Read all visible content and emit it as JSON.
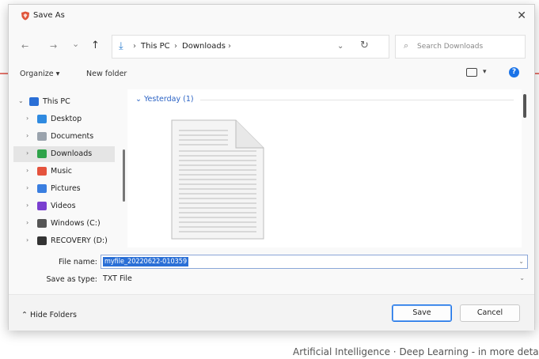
{
  "dialog": {
    "title": "Save As",
    "close_glyph": "✕"
  },
  "nav": {
    "back": "←",
    "forward": "→",
    "recent": "⌄",
    "up": "↑",
    "address": {
      "crumbs": [
        "This PC",
        "Downloads"
      ],
      "sep": "›",
      "chevron": "⌄",
      "refresh": "↻"
    },
    "search_placeholder": "Search Downloads"
  },
  "toolbar": {
    "organize": "Organize ▾",
    "new_folder": "New folder",
    "view_caret": "▾",
    "help": "?"
  },
  "tree": [
    {
      "label": "This PC",
      "caret": "⌄",
      "icon": "pc-icon",
      "color": "#2a6fd6"
    },
    {
      "label": "Desktop",
      "caret": "›",
      "icon": "desktop-icon",
      "color": "#2f8ae0"
    },
    {
      "label": "Documents",
      "caret": "›",
      "icon": "documents-icon",
      "color": "#9aa3ad"
    },
    {
      "label": "Downloads",
      "caret": "›",
      "icon": "downloads-icon",
      "color": "#2fa34a",
      "selected": true
    },
    {
      "label": "Music",
      "caret": "›",
      "icon": "music-icon",
      "color": "#e5533d"
    },
    {
      "label": "Pictures",
      "caret": "›",
      "icon": "pictures-icon",
      "color": "#3a7ee0"
    },
    {
      "label": "Videos",
      "caret": "›",
      "icon": "videos-icon",
      "color": "#7a3fd0"
    },
    {
      "label": "Windows (C:)",
      "caret": "›",
      "icon": "drive-icon",
      "color": "#555555"
    },
    {
      "label": "RECOVERY (D:)",
      "caret": "›",
      "icon": "drive-icon",
      "color": "#333333"
    }
  ],
  "content": {
    "group_header": "Yesterday (1)",
    "group_caret": "⌄"
  },
  "fields": {
    "file_name_label": "File name:",
    "file_name_value": "myfile_20220622-010359",
    "save_type_label": "Save as type:",
    "save_type_value": "TXT File",
    "chev": "⌄"
  },
  "bottom": {
    "hide_folders": "Hide Folders",
    "save": "Save",
    "cancel": "Cancel"
  },
  "background": {
    "letter": "t",
    "footer": "Artificial Intelligence  ·  Deep Learning - in more detail"
  }
}
